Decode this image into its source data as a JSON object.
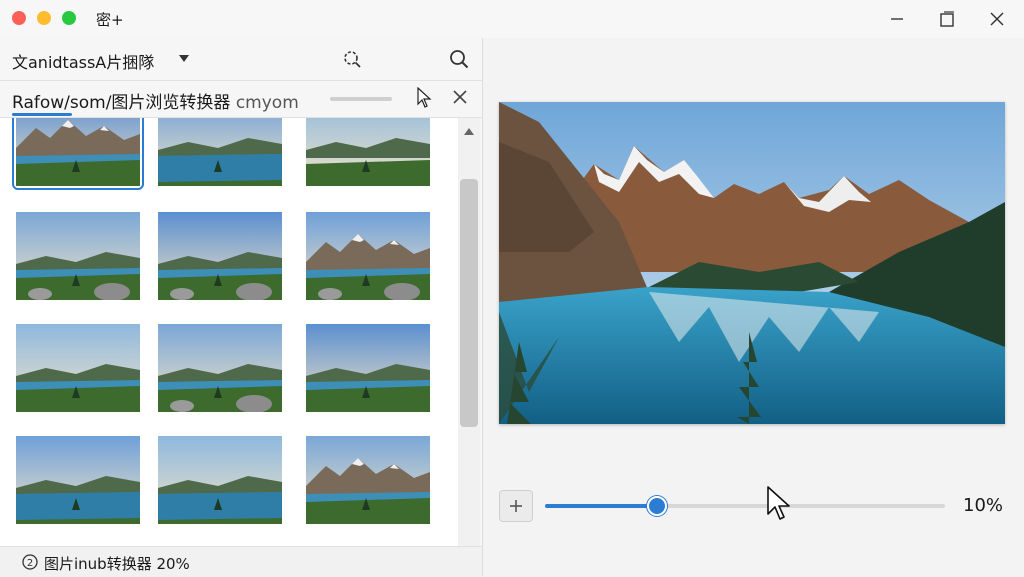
{
  "window": {
    "title": "密+",
    "controls": {
      "minimize": "minimize-icon",
      "maximize": "maximize-icon",
      "close": "close-icon"
    },
    "traffic_lights": [
      "#ff5f57",
      "#febc2e",
      "#28c840"
    ]
  },
  "toolbar": {
    "folder_title": "文anidtassA片捆隊",
    "icons": [
      "chevron-down-icon",
      "filter-search-icon",
      "search-icon"
    ]
  },
  "tab": {
    "label": "Rafow/som/图片浏览转换器",
    "sub_label": "cmyom",
    "close_icon": "close-icon"
  },
  "thumbnails": [
    {
      "scene": "lake-mountains",
      "selected": true
    },
    {
      "scene": "lake-reflection"
    },
    {
      "scene": "sunset-meadow"
    },
    {
      "scene": "meadow-lake-rocks"
    },
    {
      "scene": "meadow-lake-rocks"
    },
    {
      "scene": "mountain-lake-rocks"
    },
    {
      "scene": "meadow-lake"
    },
    {
      "scene": "meadow-lake-rocks"
    },
    {
      "scene": "meadow-lake"
    },
    {
      "scene": "lake-reflection"
    },
    {
      "scene": "lake-reflection"
    },
    {
      "scene": "lake-mountains"
    }
  ],
  "status": {
    "icon": "circle-2-icon",
    "text": "图片inub转换器 20%"
  },
  "viewer": {
    "zoom_label": "10%",
    "zoom_slider_fraction": 0.28,
    "zoom_in_icon": "plus-icon"
  },
  "colors": {
    "accent": "#2b7cd3",
    "lake": "#1f7fa8",
    "forest": "#1f3d2a",
    "sky": "#9cc3e6"
  }
}
